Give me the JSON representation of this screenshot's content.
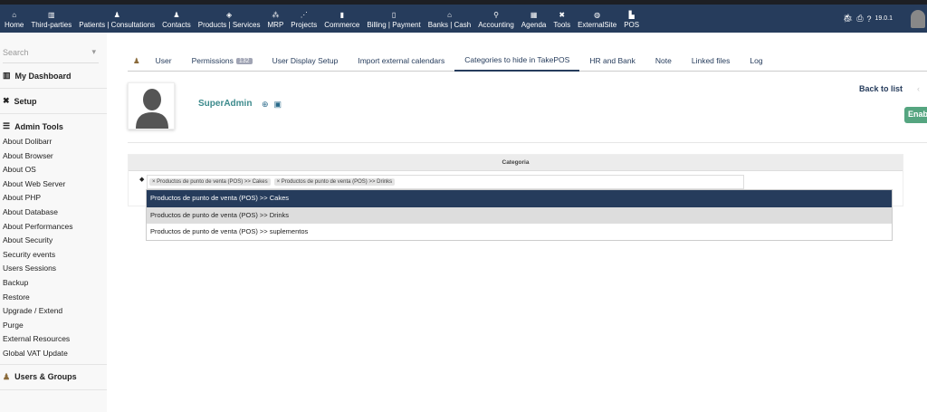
{
  "topnav": {
    "items": [
      {
        "icon": "home-icon",
        "glyph": "⌂",
        "label": "Home"
      },
      {
        "icon": "building-icon",
        "glyph": "▥",
        "label": "Third-parties"
      },
      {
        "icon": "user-icon",
        "glyph": "♟",
        "label": "Patients | Consultations"
      },
      {
        "icon": "contacts-icon",
        "glyph": "♟",
        "label": "Contacts"
      },
      {
        "icon": "cube-icon",
        "glyph": "◈",
        "label": "Products | Services"
      },
      {
        "icon": "cubes-icon",
        "glyph": "⁂",
        "label": "MRP"
      },
      {
        "icon": "project-icon",
        "glyph": "⋰",
        "label": "Projects"
      },
      {
        "icon": "briefcase-icon",
        "glyph": "▮",
        "label": "Commerce"
      },
      {
        "icon": "invoice-icon",
        "glyph": "▯",
        "label": "Billing | Payment"
      },
      {
        "icon": "bank-icon",
        "glyph": "⌂",
        "label": "Banks | Cash"
      },
      {
        "icon": "search-dollar-icon",
        "glyph": "⚲",
        "label": "Accounting"
      },
      {
        "icon": "calendar-icon",
        "glyph": "▦",
        "label": "Agenda"
      },
      {
        "icon": "tools-icon",
        "glyph": "✖",
        "label": "Tools"
      },
      {
        "icon": "globe-icon",
        "glyph": "◍",
        "label": "ExternalSite"
      },
      {
        "icon": "cash-register-icon",
        "glyph": "▙",
        "label": "POS"
      }
    ],
    "version": "19.0.1"
  },
  "sidebar": {
    "search_placeholder": "Search",
    "dashboard": "My Dashboard",
    "setup": "Setup",
    "admin_tools": "Admin Tools",
    "items": [
      "About Dolibarr",
      "About Browser",
      "About OS",
      "About Web Server",
      "About PHP",
      "About Database",
      "About Performances",
      "About Security",
      "Security events",
      "Users Sessions",
      "Backup",
      "Restore",
      "Upgrade / Extend",
      "Purge",
      "External Resources",
      "Global VAT Update"
    ],
    "users_groups": "Users & Groups"
  },
  "tabs": [
    {
      "label": "User"
    },
    {
      "label": "Permissions",
      "badge": "132"
    },
    {
      "label": "User Display Setup"
    },
    {
      "label": "Import external calendars"
    },
    {
      "label": "Categories to hide in TakePOS",
      "active": true
    },
    {
      "label": "HR and Bank"
    },
    {
      "label": "Note"
    },
    {
      "label": "Linked files"
    },
    {
      "label": "Log"
    }
  ],
  "user": {
    "name": "SuperAdmin",
    "back": "Back to list",
    "enable": "Enable"
  },
  "table": {
    "header": "Categoria",
    "chips": [
      "Productos de punto de venta (POS) >> Cakes",
      "Productos de punto de venta (POS) >> Drinks"
    ]
  },
  "dropdown": [
    "Productos de punto de venta (POS) >> Cakes",
    "Productos de punto de venta (POS) >> Drinks",
    "Productos de punto de venta (POS) >> suplementos"
  ],
  "colors": {
    "nav": "#263c5c",
    "green": "#55a580",
    "name": "#3c8a8c"
  }
}
